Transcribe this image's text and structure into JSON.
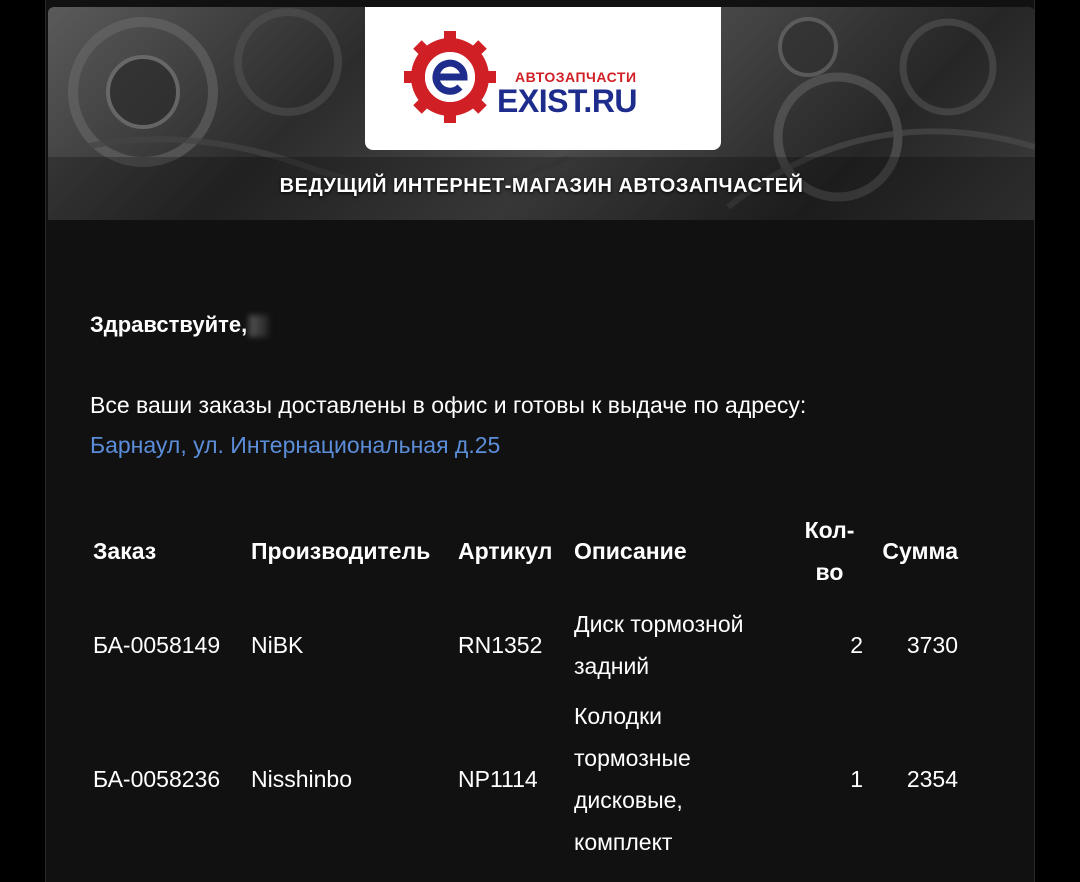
{
  "banner": {
    "logo_small": "АВТОЗАПЧАСТИ",
    "logo_big": "EXIST.RU",
    "tagline": "ВЕДУЩИЙ ИНТЕРНЕТ-МАГАЗИН АВТОЗАПЧАСТЕЙ",
    "brand_red": "#d11f26",
    "brand_blue": "#1e2c8c"
  },
  "greeting": "Здравствуйте,",
  "intro": "Все ваши заказы доставлены в офис и готовы к выдаче по адресу:",
  "address": "Барнаул, ул. Интернациональная д.25",
  "link_color": "#5b8dd9",
  "table": {
    "headers": {
      "order": "Заказ",
      "maker": "Производитель",
      "sku": "Артикул",
      "desc": "Описание",
      "qty_line1": "Кол-",
      "qty_line2": "во",
      "sum": "Сумма"
    },
    "rows": [
      {
        "order": "БА-0058149",
        "maker": "NiBK",
        "sku": "RN1352",
        "desc_lines": [
          "Диск тормозной",
          "задний"
        ],
        "qty": "2",
        "sum": "3730"
      },
      {
        "order": "БА-0058236",
        "maker": "Nisshinbo",
        "sku": "NP1114",
        "desc_lines": [
          "Колодки",
          "тормозные",
          "дисковые,",
          "комплект"
        ],
        "qty": "1",
        "sum": "2354"
      }
    ]
  }
}
